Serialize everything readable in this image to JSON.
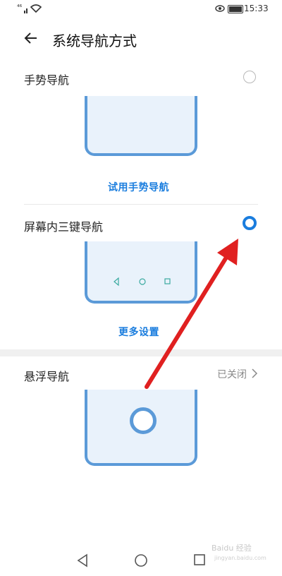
{
  "status": {
    "signal": "⁴⁶",
    "time": "15:33",
    "battery": "100"
  },
  "header": {
    "title": "系统导航方式"
  },
  "gesture": {
    "label": "手势导航",
    "link": "试用手势导航"
  },
  "threekey": {
    "label": "屏幕内三键导航",
    "link": "更多设置"
  },
  "floating": {
    "label": "悬浮导航",
    "state": "已关闭"
  },
  "watermark": "Baidu 经验",
  "watermark_sub": "jingyan.baidu.com"
}
